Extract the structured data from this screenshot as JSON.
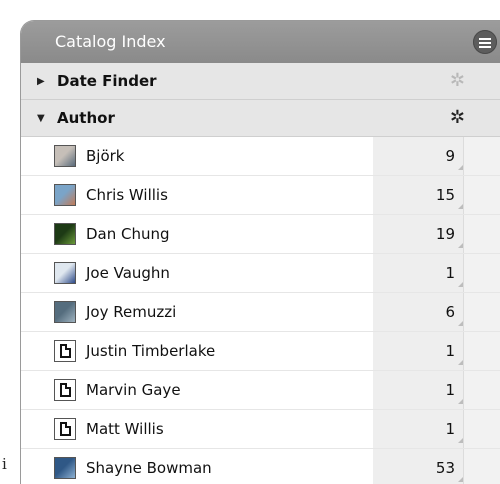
{
  "stray_text": "i",
  "panel": {
    "title": "Catalog Index"
  },
  "sections": [
    {
      "label": "Date Finder",
      "expanded": false,
      "icon": "gear-icon-dim"
    },
    {
      "label": "Author",
      "expanded": true,
      "icon": "gear-icon"
    }
  ],
  "authors": [
    {
      "name": "Björk",
      "count": "9",
      "thumb": "photo",
      "thumb_colors": [
        "#c6bfb8",
        "#5a6b7b"
      ]
    },
    {
      "name": "Chris Willis",
      "count": "15",
      "thumb": "photo",
      "thumb_colors": [
        "#7aa4c8",
        "#c07a58"
      ]
    },
    {
      "name": "Dan Chung",
      "count": "19",
      "thumb": "photo",
      "thumb_colors": [
        "#1d3a15",
        "#6a9a3a"
      ]
    },
    {
      "name": "Joe Vaughn",
      "count": "1",
      "thumb": "photo",
      "thumb_colors": [
        "#dfe7ef",
        "#2e4a88"
      ]
    },
    {
      "name": "Joy Remuzzi",
      "count": "6",
      "thumb": "photo",
      "thumb_colors": [
        "#556d7e",
        "#9fb3c0"
      ]
    },
    {
      "name": "Justin Timberlake",
      "count": "1",
      "thumb": "document"
    },
    {
      "name": "Marvin Gaye",
      "count": "1",
      "thumb": "document"
    },
    {
      "name": "Matt Willis",
      "count": "1",
      "thumb": "document"
    },
    {
      "name": "Shayne Bowman",
      "count": "53",
      "thumb": "photo",
      "thumb_colors": [
        "#2f5886",
        "#8db1d3"
      ]
    }
  ]
}
